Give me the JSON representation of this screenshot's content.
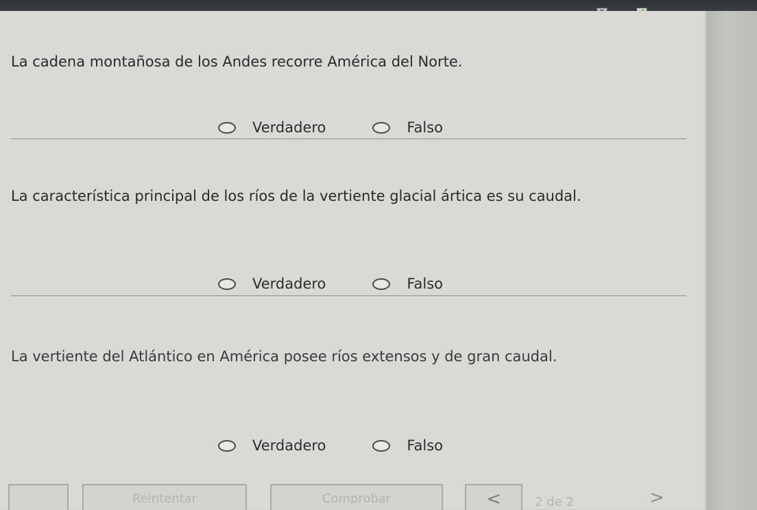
{
  "questions": [
    {
      "text": "La cadena montañosa de los Andes recorre América del Norte.",
      "options": {
        "true_label": "Verdadero",
        "false_label": "Falso"
      }
    },
    {
      "text": "La característica principal de los ríos de la vertiente glacial ártica es su caudal.",
      "options": {
        "true_label": "Verdadero",
        "false_label": "Falso"
      }
    },
    {
      "text": "La vertiente del Atlántico en América posee ríos extensos y de gran caudal.",
      "options": {
        "true_label": "Verdadero",
        "false_label": "Falso"
      }
    }
  ],
  "footer": {
    "retry_label": "Reintentar",
    "check_label": "Comprobar",
    "prev_symbol": "<",
    "next_symbol": ">",
    "page_indicator": "2 de 2"
  },
  "icons": {
    "close": "close-icon",
    "check": "check-icon"
  }
}
